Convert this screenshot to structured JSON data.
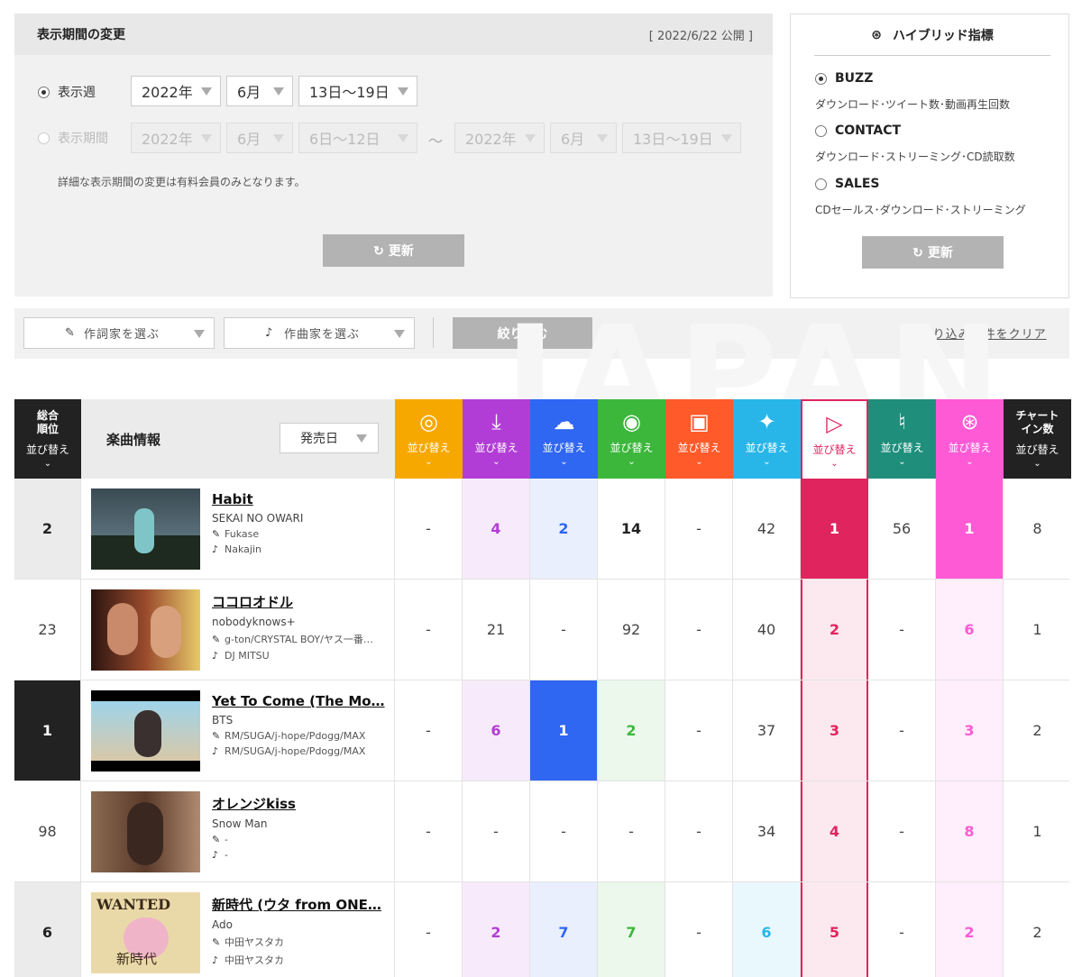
{
  "period": {
    "title": "表示期間の変更",
    "published": "[ 2022/6/22 公開 ]",
    "week_label": "表示週",
    "week_year": "2022年",
    "week_month": "6月",
    "week_range": "13日〜19日",
    "range_label": "表示期間",
    "from_year": "2022年",
    "from_month": "6月",
    "from_range": "6日〜12日",
    "tilde": "〜",
    "to_year": "2022年",
    "to_month": "6月",
    "to_range": "13日〜19日",
    "note": "詳細な表示期間の変更は有料会員のみとなります。",
    "update_label": "更新"
  },
  "hybrid": {
    "title": "ハイブリッド指標",
    "options": [
      {
        "label": "BUZZ",
        "desc": "ダウンロード･ツイート数･動画再生回数",
        "selected": true
      },
      {
        "label": "CONTACT",
        "desc": "ダウンロード･ストリーミング･CD読取数",
        "selected": false
      },
      {
        "label": "SALES",
        "desc": "CDセールス･ダウンロード･ストリーミング",
        "selected": false
      }
    ],
    "update_label": "更新"
  },
  "filter": {
    "lyricist_label": "作詞家を選ぶ",
    "composer_label": "作曲家を選ぶ",
    "apply_label": "絞り込む",
    "clear_label": "絞り込み条件をクリア"
  },
  "watermark": "JAPAN",
  "table": {
    "rank_header": "総合\n順位",
    "info_header": "楽曲情報",
    "release_label": "発売日",
    "sort_label": "並び替え",
    "chartin_header": "チャート\nイン数",
    "columns": [
      {
        "key": "cd",
        "icon": "cd-sales-icon",
        "glyph": "◎",
        "color": "#f7a800"
      },
      {
        "key": "download",
        "icon": "download-icon",
        "glyph": "⤓",
        "color": "#b23dd6"
      },
      {
        "key": "streaming",
        "icon": "streaming-cloud-icon",
        "glyph": "☁",
        "color": "#2f66f2"
      },
      {
        "key": "radio",
        "icon": "radio-icon",
        "glyph": "◉",
        "color": "#3cb73c"
      },
      {
        "key": "lookup",
        "icon": "pc-cd-lookup-icon",
        "glyph": "▣",
        "color": "#ff5a2a"
      },
      {
        "key": "twitter",
        "icon": "twitter-bird-icon",
        "glyph": "✦",
        "color": "#28b6e8"
      },
      {
        "key": "youtube",
        "icon": "youtube-play-icon",
        "glyph": "▷",
        "color": "#e0245e"
      },
      {
        "key": "karaoke",
        "icon": "karaoke-mic-icon",
        "glyph": "♮",
        "color": "#1f8f7c"
      },
      {
        "key": "hybrid",
        "icon": "hybrid-circles-icon",
        "glyph": "⊛",
        "color": "#ff5ad6"
      }
    ],
    "rows": [
      {
        "rank": "2",
        "title": "Habit",
        "artist": "SEKAI NO OWARI",
        "lyricist": "Fukase",
        "composer": "Nakajin",
        "values": [
          "-",
          "4",
          "2",
          "14",
          "-",
          "42",
          "1",
          "56",
          "1"
        ],
        "chartin": "8"
      },
      {
        "rank": "23",
        "title": "ココロオドル",
        "artist": "nobodyknows+",
        "lyricist": "g-ton/CRYSTAL BOY/ヤス一番…",
        "composer": "DJ MITSU",
        "values": [
          "-",
          "21",
          "-",
          "92",
          "-",
          "40",
          "2",
          "-",
          "6"
        ],
        "chartin": "1"
      },
      {
        "rank": "1",
        "title": "Yet To Come (The Mo…",
        "artist": "BTS",
        "lyricist": "RM/SUGA/j-hope/Pdogg/MAX",
        "composer": "RM/SUGA/j-hope/Pdogg/MAX",
        "values": [
          "-",
          "6",
          "1",
          "2",
          "-",
          "37",
          "3",
          "-",
          "3"
        ],
        "chartin": "2"
      },
      {
        "rank": "98",
        "title": "オレンジkiss",
        "artist": "Snow Man",
        "lyricist": "-",
        "composer": "-",
        "values": [
          "-",
          "-",
          "-",
          "-",
          "-",
          "34",
          "4",
          "-",
          "8"
        ],
        "chartin": "1"
      },
      {
        "rank": "6",
        "title": "新時代 (ウタ from ONE…",
        "artist": "Ado",
        "lyricist": "中田ヤスタカ",
        "composer": "中田ヤスタカ",
        "values": [
          "-",
          "2",
          "7",
          "7",
          "-",
          "6",
          "5",
          "-",
          "2"
        ],
        "chartin": "2"
      }
    ]
  }
}
